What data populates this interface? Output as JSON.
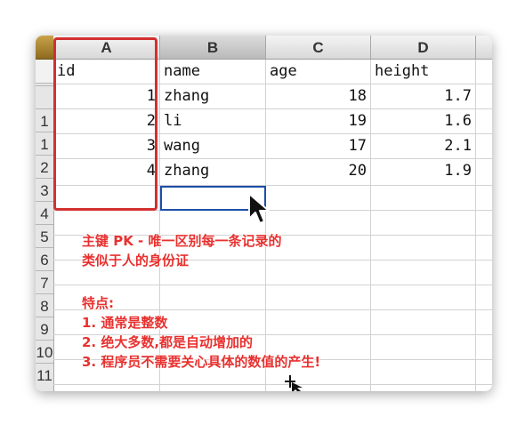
{
  "colors": {
    "accent_red": "#d23030",
    "annotation_red": "#e8312f",
    "selection_blue": "#1c4fa8"
  },
  "columns": [
    {
      "letter": "A"
    },
    {
      "letter": "B"
    },
    {
      "letter": "C"
    },
    {
      "letter": "D"
    }
  ],
  "row_numbers": [
    "",
    "1",
    "1",
    "2",
    "3",
    "4",
    "5",
    "6",
    "7",
    "8",
    "9",
    "10",
    "11"
  ],
  "table": {
    "header": [
      "id",
      "name",
      "age",
      "height"
    ],
    "rows": [
      [
        "1",
        "zhang",
        "18",
        "1.7"
      ],
      [
        "2",
        "li",
        "19",
        "1.6"
      ],
      [
        "3",
        "wang",
        "17",
        "2.1"
      ],
      [
        "4",
        "zhang",
        "20",
        "1.9"
      ]
    ]
  },
  "annotation": {
    "line1": "主键 PK - 唯一区别每一条记录的",
    "line2": "类似于人的身份证",
    "features_title": "特点:",
    "point1": "1. 通常是整数",
    "point2": "2. 绝大多数,都是自动增加的",
    "point3": "3. 程序员不需要关心具体的数值的产生!"
  },
  "icons": [
    "arrow-cursor-icon",
    "crosshair-cursor-icon",
    "app-icon"
  ]
}
